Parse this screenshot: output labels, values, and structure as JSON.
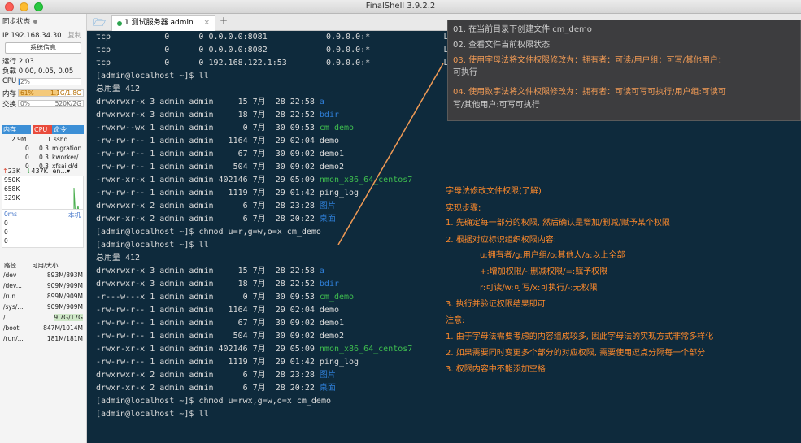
{
  "app_title": "FinalShell 3.9.2.2",
  "sidebar": {
    "sync_status": "同步状态",
    "ip": "IP 192.168.34.30",
    "copy": "复制",
    "sys_info_button": "系统信息",
    "uptime": "运行 2:03",
    "load": "负载 0.00, 0.05, 0.05",
    "cpu_label": "CPU",
    "cpu_value": "2%",
    "cpu_pct": 2,
    "mem_label": "内存",
    "mem_pct_text": "61%",
    "mem_pct": 61,
    "mem_value": "1.1G/1.8G",
    "swap_label": "交换",
    "swap_pct_text": "0%",
    "swap_value": "520K/2G",
    "proc_headers": [
      "内存",
      "CPU",
      "命令"
    ],
    "processes": [
      {
        "mem": "2.9M",
        "cpu": "1",
        "cmd": "sshd"
      },
      {
        "mem": "0",
        "cpu": "0.3",
        "cmd": "migration"
      },
      {
        "mem": "0",
        "cpu": "0.3",
        "cmd": "kworker/"
      },
      {
        "mem": "0",
        "cpu": "0.3",
        "cmd": "xfsaild/d"
      }
    ],
    "net_up": "23K",
    "net_down": "437K",
    "net_iface": "en...",
    "net_levels": [
      "950K",
      "658K",
      "329K"
    ],
    "latency_label": "0ms",
    "latency_host": "本机",
    "latency_levels": [
      "0",
      "0",
      "0"
    ],
    "disk_headers": [
      "路径",
      "可用/大小"
    ],
    "disks": [
      {
        "path": "/dev",
        "size": "893M/893M"
      },
      {
        "path": "/dev...",
        "size": "909M/909M"
      },
      {
        "path": "/run",
        "size": "899M/909M"
      },
      {
        "path": "/sys/...",
        "size": "909M/909M"
      },
      {
        "path": "/",
        "size": "9.7G/17G"
      },
      {
        "path": "/boot",
        "size": "847M/1014M"
      },
      {
        "path": "/run/...",
        "size": "181M/181M"
      }
    ]
  },
  "tabs": {
    "active_label": "1 测试服务器 admin",
    "close": "×",
    "add": "+"
  },
  "terminal": {
    "netstat": [
      {
        "proto": "tcp",
        "recv": "0",
        "send": "0",
        "local": "0.0.0.0:8081",
        "foreign": "0.0.0.0:*",
        "state": "LI"
      },
      {
        "proto": "tcp",
        "recv": "0",
        "send": "0",
        "local": "0.0.0.0:8082",
        "foreign": "0.0.0.0:*",
        "state": "LI"
      },
      {
        "proto": "tcp",
        "recv": "0",
        "send": "0",
        "local": "192.168.122.1:53",
        "foreign": "0.0.0.0:*",
        "state": "LI"
      }
    ],
    "prompt": "[admin@localhost ~]$",
    "cmd_ll": "ll",
    "total": "总用量 412",
    "listing1": [
      {
        "perm": "drwxrwxr-x",
        "links": "3",
        "user": "admin",
        "group": "admin",
        "size": "15",
        "month": "7月",
        "day": "28",
        "time": "22:58",
        "name": "a",
        "color": "#2f7fd8"
      },
      {
        "perm": "drwxrwxr-x",
        "links": "3",
        "user": "admin",
        "group": "admin",
        "size": "18",
        "month": "7月",
        "day": "28",
        "time": "22:52",
        "name": "bdir",
        "color": "#2f7fd8"
      },
      {
        "perm": "-rwxrw--wx",
        "links": "1",
        "user": "admin",
        "group": "admin",
        "size": "0",
        "month": "7月",
        "day": "30",
        "time": "09:53",
        "name": "cm_demo",
        "color": "#3fbf4f"
      },
      {
        "perm": "-rw-rw-r--",
        "links": "1",
        "user": "admin",
        "group": "admin",
        "size": "1164",
        "month": "7月",
        "day": "29",
        "time": "02:04",
        "name": "demo",
        "color": "#dcdcdc"
      },
      {
        "perm": "-rw-rw-r--",
        "links": "1",
        "user": "admin",
        "group": "admin",
        "size": "67",
        "month": "7月",
        "day": "30",
        "time": "09:02",
        "name": "demo1",
        "color": "#dcdcdc"
      },
      {
        "perm": "-rw-rw-r--",
        "links": "1",
        "user": "admin",
        "group": "admin",
        "size": "504",
        "month": "7月",
        "day": "30",
        "time": "09:02",
        "name": "demo2",
        "color": "#dcdcdc"
      },
      {
        "perm": "-rwxr-xr-x",
        "links": "1",
        "user": "admin",
        "group": "admin",
        "size": "402146",
        "month": "7月",
        "day": "29",
        "time": "05:09",
        "name": "nmon_x86_64_centos7",
        "color": "#3fbf4f"
      },
      {
        "perm": "-rw-rw-r--",
        "links": "1",
        "user": "admin",
        "group": "admin",
        "size": "1119",
        "month": "7月",
        "day": "29",
        "time": "01:42",
        "name": "ping_log",
        "color": "#dcdcdc"
      },
      {
        "perm": "drwxrwxr-x",
        "links": "2",
        "user": "admin",
        "group": "admin",
        "size": "6",
        "month": "7月",
        "day": "28",
        "time": "23:28",
        "name": "图片",
        "color": "#2f7fd8"
      },
      {
        "perm": "drwxr-xr-x",
        "links": "2",
        "user": "admin",
        "group": "admin",
        "size": "6",
        "month": "7月",
        "day": "28",
        "time": "20:22",
        "name": "桌面",
        "color": "#2f7fd8"
      }
    ],
    "chmod1": "chmod u=r,g=w,o=x cm_demo",
    "listing2": [
      {
        "perm": "drwxrwxr-x",
        "links": "3",
        "user": "admin",
        "group": "admin",
        "size": "15",
        "month": "7月",
        "day": "28",
        "time": "22:58",
        "name": "a",
        "color": "#2f7fd8"
      },
      {
        "perm": "drwxrwxr-x",
        "links": "3",
        "user": "admin",
        "group": "admin",
        "size": "18",
        "month": "7月",
        "day": "28",
        "time": "22:52",
        "name": "bdir",
        "color": "#2f7fd8"
      },
      {
        "perm": "-r---w---x",
        "links": "1",
        "user": "admin",
        "group": "admin",
        "size": "0",
        "month": "7月",
        "day": "30",
        "time": "09:53",
        "name": "cm_demo",
        "color": "#3fbf4f"
      },
      {
        "perm": "-rw-rw-r--",
        "links": "1",
        "user": "admin",
        "group": "admin",
        "size": "1164",
        "month": "7月",
        "day": "29",
        "time": "02:04",
        "name": "demo",
        "color": "#dcdcdc"
      },
      {
        "perm": "-rw-rw-r--",
        "links": "1",
        "user": "admin",
        "group": "admin",
        "size": "67",
        "month": "7月",
        "day": "30",
        "time": "09:02",
        "name": "demo1",
        "color": "#dcdcdc"
      },
      {
        "perm": "-rw-rw-r--",
        "links": "1",
        "user": "admin",
        "group": "admin",
        "size": "504",
        "month": "7月",
        "day": "30",
        "time": "09:02",
        "name": "demo2",
        "color": "#dcdcdc"
      },
      {
        "perm": "-rwxr-xr-x",
        "links": "1",
        "user": "admin",
        "group": "admin",
        "size": "402146",
        "month": "7月",
        "day": "29",
        "time": "05:09",
        "name": "nmon_x86_64_centos7",
        "color": "#3fbf4f"
      },
      {
        "perm": "-rw-rw-r--",
        "links": "1",
        "user": "admin",
        "group": "admin",
        "size": "1119",
        "month": "7月",
        "day": "29",
        "time": "01:42",
        "name": "ping_log",
        "color": "#dcdcdc"
      },
      {
        "perm": "drwxrwxr-x",
        "links": "2",
        "user": "admin",
        "group": "admin",
        "size": "6",
        "month": "7月",
        "day": "28",
        "time": "23:28",
        "name": "图片",
        "color": "#2f7fd8"
      },
      {
        "perm": "drwxr-xr-x",
        "links": "2",
        "user": "admin",
        "group": "admin",
        "size": "6",
        "month": "7月",
        "day": "28",
        "time": "20:22",
        "name": "桌面",
        "color": "#2f7fd8"
      }
    ],
    "chmod2": "chmod u=rwx,g=w,o=x cm_demo"
  },
  "notes": [
    "01. 在当前目录下创建文件 cm_demo",
    "02. 查看文件当前权限状态",
    "03. 使用字母法将文件权限修改为：拥有者：可读/用户组：可写/其他用户：",
    "可执行",
    "04. 使用数字法将文件权限修改为：拥有者：可读可写可执行/用户组:可读可",
    "写/其他用户:可写可执行"
  ],
  "annotation": {
    "heading": "字母法修改文件权限(了解)",
    "steps_label": "实现步骤:",
    "step1": "1. 先确定每一部分的权限, 然后确认是增加/删减/赋予某个权限",
    "step2": "2. 根据对应标识组织权限内容:",
    "sub1": "u:拥有者/g:用户组/o:其他人/a:以上全部",
    "sub2": "+:增加权限/-:删减权限/=:赋予权限",
    "sub3": "r:可读/w:可写/x:可执行/-:无权限",
    "step3": "3. 执行并验证权限结果即可",
    "note_label": "注意:",
    "note1": "1. 由于字母法需要考虑的内容组成较多, 因此字母法的实现方式非常多样化",
    "note2": "2. 如果需要同时变更多个部分的对应权限, 需要使用逗点分隔每一个部分",
    "note3": "3. 权限内容中不能添加空格"
  },
  "colors": {
    "terminal_bg": "#0e2a3c",
    "dir": "#2f7fd8",
    "exec": "#3fbf4f",
    "annotation": "#ff8a2b",
    "cpu_fill": "#2f7fd8",
    "mem_fill": "#f4c97a"
  }
}
